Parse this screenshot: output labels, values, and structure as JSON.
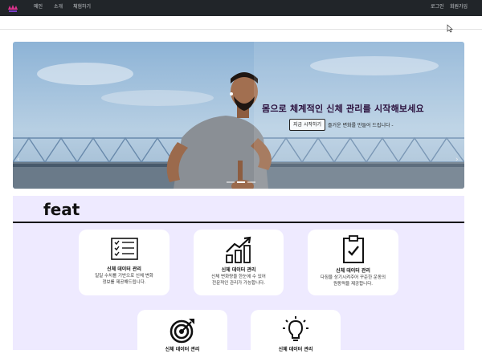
{
  "nav": {
    "links": [
      "메인",
      "소개",
      "체험하기"
    ],
    "login": "로그인",
    "signup": "회원가입"
  },
  "hero": {
    "title": "몸으로 체계적인 신체 관리를 시작해보세요",
    "cta": "지금 시작하기",
    "subtitle": "즐거운 변화를 만들어 드립니다 -",
    "prev": "‹",
    "next": "›"
  },
  "feat": {
    "title": "feat",
    "cards": [
      {
        "icon": "checklist-icon",
        "title": "신체 데이터 관리",
        "desc": [
          "일일 수치를 기반으로 신체 변화",
          "정보를 제공해드립니다."
        ]
      },
      {
        "icon": "growth-chart-icon",
        "title": "신체 데이터 관리",
        "desc": [
          "신체 변화량을 한눈에 수 있어",
          "전문적인 관리가 가능합니다."
        ]
      },
      {
        "icon": "clipboard-check-icon",
        "title": "신체 데이터 관리",
        "desc": [
          "다짐을 상기시켜주어 꾸준한 운동의",
          "원동력을 제공합니다."
        ]
      },
      {
        "icon": "target-icon",
        "title": "신체 데이터 관리",
        "desc": []
      },
      {
        "icon": "lightbulb-icon",
        "title": "신체 데이터 관리",
        "desc": []
      }
    ]
  },
  "colors": {
    "navbar": "#212529",
    "feat_bg": "#eeeaff",
    "hero_title": "#2a0f3c"
  }
}
